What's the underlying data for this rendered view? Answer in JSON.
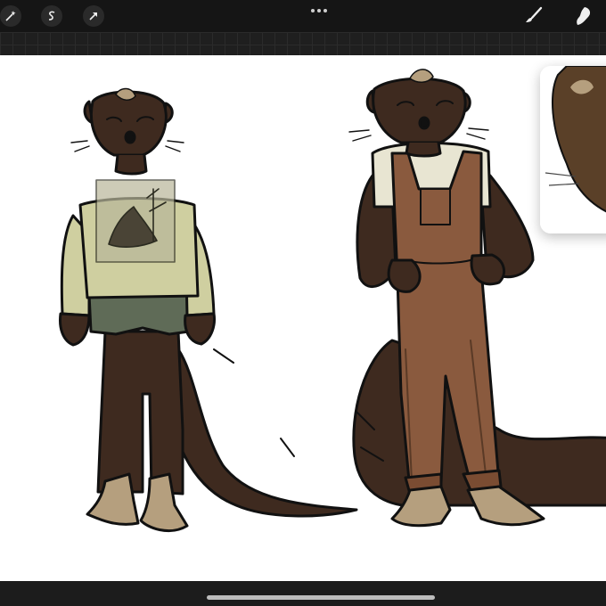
{
  "app": {
    "name": "Procreate"
  },
  "toolbar": {
    "left_tools": [
      {
        "name": "adjustments-wand",
        "icon": "magic-wand-icon"
      },
      {
        "name": "selection",
        "icon": "selection-s-icon"
      },
      {
        "name": "transform",
        "icon": "arrow-cursor-icon"
      }
    ],
    "center_menu_icon": "ellipsis-icon",
    "right_tools": [
      {
        "name": "brush",
        "icon": "brush-icon"
      },
      {
        "name": "smudge",
        "icon": "smudge-icon"
      }
    ]
  },
  "canvas": {
    "background": "#ffffff",
    "artwork": "two-weasel-character-sketches",
    "colors": {
      "fur": "#3e2a1f",
      "fur_light": "#b59f7e",
      "sweater": "#cfcfa0",
      "shorts": "#5f6b57",
      "overalls": "#8a5a3e",
      "tshirt": "#e8e5d2",
      "outline": "#111111"
    }
  },
  "reference_panel": {
    "visible": true
  }
}
